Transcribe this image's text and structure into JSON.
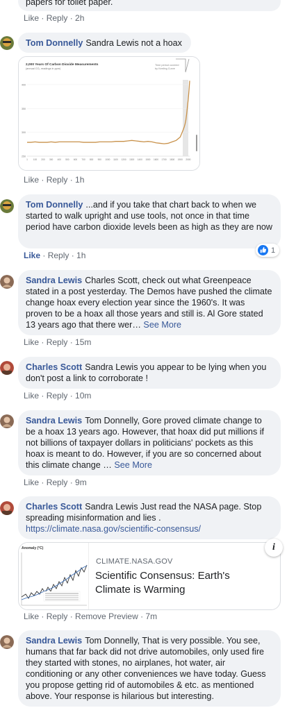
{
  "top": {
    "partial_text": "papers for toilet paper.",
    "like": "Like",
    "reply": "Reply",
    "time": "2h"
  },
  "comments": [
    {
      "author": "Tom Donnelly",
      "text": "Sandra Lewis not a hoax",
      "like": "Like",
      "reply": "Reply",
      "time": "1h"
    },
    {
      "author": "Tom Donnelly",
      "text": "...and if you take that chart back to when we started to walk upright and use tools, not once in that time period have carbon dioxide levels been as high as they are now",
      "like": "Like",
      "reply": "Reply",
      "time": "1h",
      "reaction_count": "1"
    },
    {
      "author": "Sandra Lewis",
      "text": "Charles Scott, check out what Greenpeace stated in a post yesterday. The Demos have pushed the climate change hoax every election year since the 1960's. It was proven to be a hoax all those years and still is. Al Gore stated 13 years ago that there wer…",
      "see_more": "See More",
      "like": "Like",
      "reply": "Reply",
      "time": "15m"
    },
    {
      "author": "Charles Scott",
      "text": "Sandra Lewis you appear to be lying when you don't post a link to corroborate !",
      "like": "Like",
      "reply": "Reply",
      "time": "10m"
    },
    {
      "author": "Sandra Lewis",
      "text": "Tom Donnelly, Gore proved climate change to be a hoax 13 years ago. However, that hoax did put millions if not billions of taxpayer dollars in politicians' pockets as this hoax is meant to do. However, if you are so concerned about this climate change …",
      "see_more": "See More",
      "like": "Like",
      "reply": "Reply",
      "time": "9m"
    },
    {
      "author": "Charles Scott",
      "text": "Sandra Lewis Just read the NASA page. Stop spreading misinformation and lies .",
      "url": "https://climate.nasa.gov/scientific-consensus/",
      "like": "Like",
      "reply": "Reply",
      "remove_preview": "Remove Preview",
      "time": "7m"
    },
    {
      "author": "Sandra Lewis",
      "text": "Tom Donnelly, That is very possible. You see, humans that far back did not drive automobiles, only used fire they started with stones, no airplanes, hot water, air conditioning or any other conveniences we have today. Guess you propose getting rid of automobiles & etc. as mentioned above. Your response is hilarious but interesting."
    }
  ],
  "co2_chart": {
    "title": "2,000 Years Of Carbon Dioxide Measurements",
    "subtitle": "(annual CO₂ readings in ppm)",
    "note_line1": "Time period covered",
    "note_line2": "by Keeling Curve",
    "line_color": "#c8914a",
    "chart_data": {
      "type": "line",
      "x": [
        1,
        50,
        100,
        150,
        200,
        250,
        300,
        350,
        400,
        450,
        500,
        550,
        600,
        650,
        700,
        750,
        800,
        850,
        900,
        950,
        1000,
        1050,
        1100,
        1150,
        1200,
        1250,
        1300,
        1350,
        1400,
        1450,
        1500,
        1550,
        1600,
        1650,
        1700,
        1750,
        1800,
        1850,
        1900,
        1925,
        1950,
        1960,
        1970,
        1980,
        1990,
        2000,
        2010,
        2018
      ],
      "y": [
        279,
        279,
        280,
        279,
        279,
        279,
        280,
        279,
        280,
        280,
        280,
        280,
        280,
        280,
        279,
        279,
        279,
        279,
        280,
        280,
        280,
        280,
        281,
        281,
        281,
        282,
        283,
        282,
        281,
        280,
        281,
        280,
        278,
        277,
        276,
        277,
        280,
        283,
        290,
        300,
        311,
        317,
        325,
        338,
        354,
        369,
        389,
        408
      ],
      "ylim": [
        250,
        410
      ],
      "xlim": [
        1,
        2018
      ],
      "ytick_labels": [
        "250",
        "300",
        "350",
        "400"
      ],
      "xtick_labels": [
        "1",
        "100",
        "200",
        "300",
        "400",
        "500",
        "600",
        "700",
        "800",
        "900",
        "1000",
        "1100",
        "1200",
        "1300",
        "1400",
        "1500",
        "1600",
        "1700",
        "1800",
        "1900",
        "2000"
      ]
    }
  },
  "link_card": {
    "domain": "CLIMATE.NASA.GOV",
    "title": "Scientific Consensus: Earth's Climate is Warming",
    "thumb_title": "Anomaly (°C)",
    "info_icon": "i"
  },
  "colors": {
    "author": "#385898",
    "bubble": "#f0f2f5",
    "meta": "#606770",
    "like_blue": "#1877f2"
  }
}
